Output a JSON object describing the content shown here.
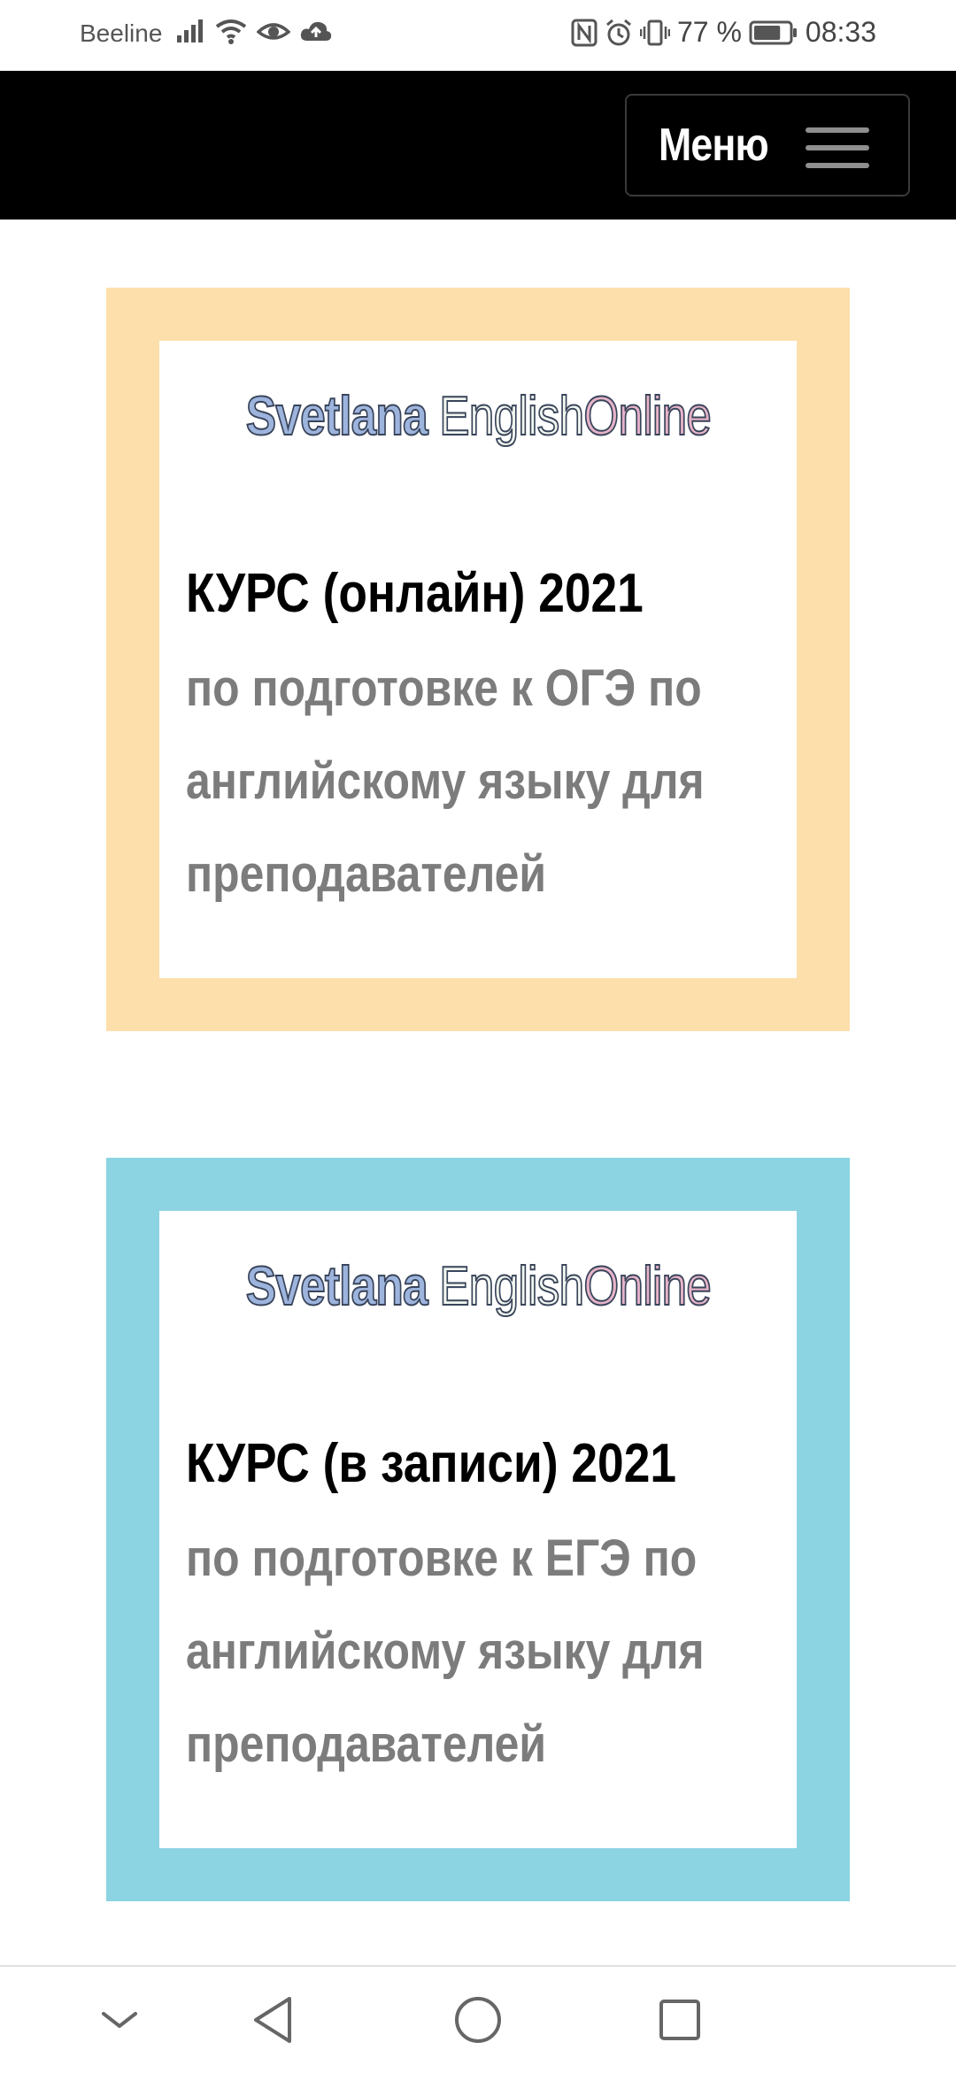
{
  "status_bar": {
    "carrier": "Beeline",
    "battery": "77 %",
    "time": "08:33",
    "icons_left": [
      "signal-icon",
      "wifi-icon",
      "eye-icon",
      "cloud-icon"
    ],
    "icons_right": [
      "nfc-icon",
      "alarm-icon",
      "vibrate-icon",
      "battery-icon"
    ],
    "battery_level": 0.77
  },
  "header": {
    "menu_label": "Меню",
    "menu_icon": "hamburger-icon",
    "background": "#000000"
  },
  "cards": [
    {
      "logo": [
        "Svetlana",
        "English",
        "Online"
      ],
      "title": "КУРС (онлайн) 2021",
      "description": "по подготовке к ОГЭ по английскому языку для преподавателей",
      "frame_color": "#fddfac"
    },
    {
      "logo": [
        "Svetlana",
        "English",
        "Online"
      ],
      "title": "КУРС (в записи) 2021",
      "description": "по подготовке к ЕГЭ по английскому языку для преподавателей",
      "frame_color": "#8cd4e1"
    }
  ],
  "nav_bar": {
    "icons": [
      "collapse-icon",
      "back-icon",
      "home-icon",
      "recents-icon"
    ]
  },
  "colors": {
    "logo_blue": "#9db4dd",
    "logo_pink": "#e6b3c8",
    "title": "#000000",
    "description": "#7c7c7c"
  }
}
